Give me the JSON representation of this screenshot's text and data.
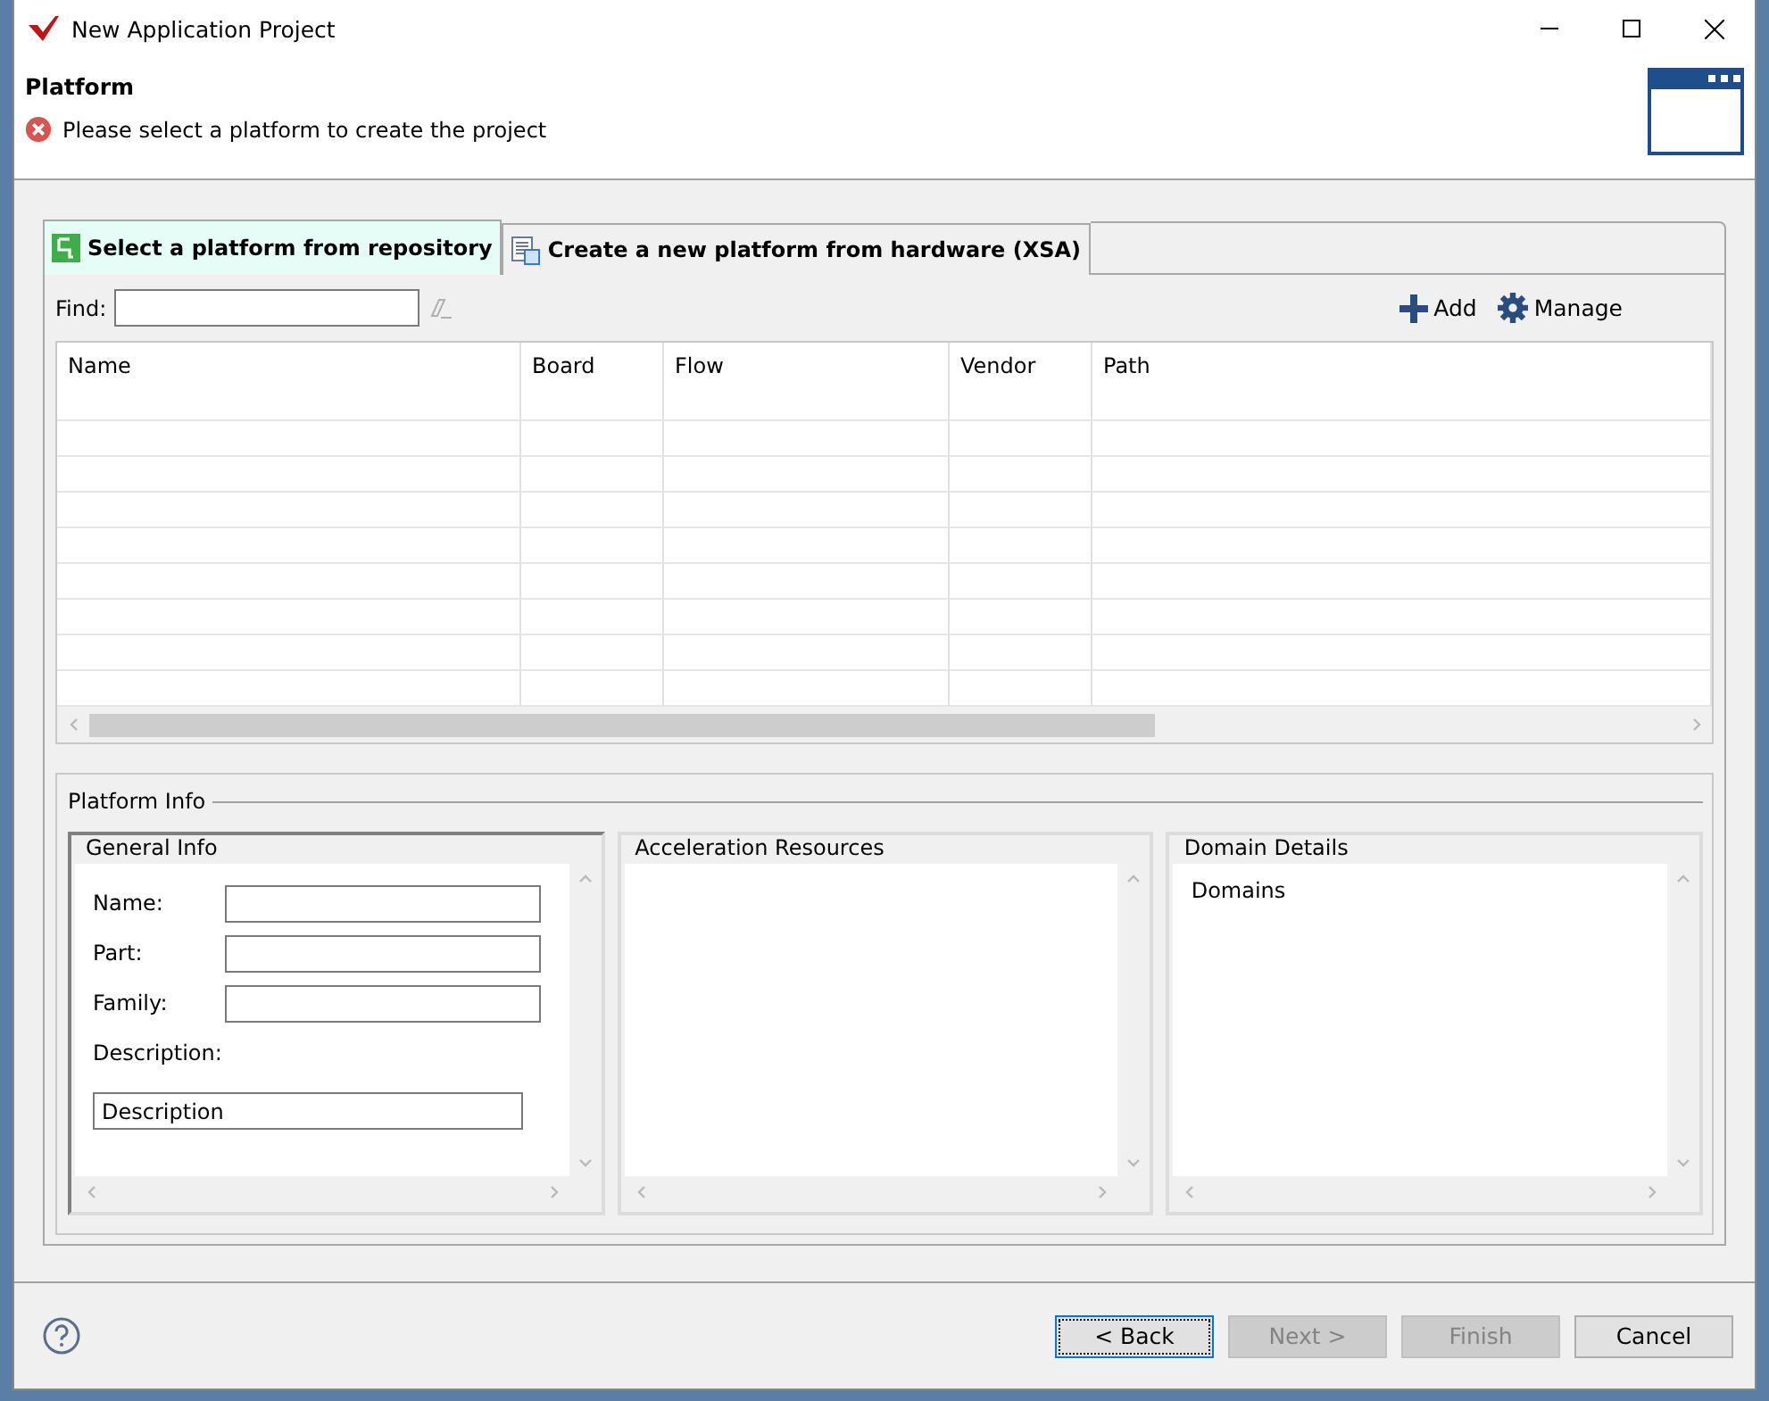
{
  "window": {
    "title": "New Application Project"
  },
  "header": {
    "title": "Platform",
    "message": "Please select a platform to create the project"
  },
  "tabs": [
    {
      "label": "Select a platform from repository",
      "selected": true
    },
    {
      "label": "Create a new platform from hardware (XSA)",
      "selected": false
    }
  ],
  "find": {
    "label": "Find:"
  },
  "toolbar": [
    {
      "kind": "add",
      "label": "Add"
    },
    {
      "kind": "manage",
      "label": "Manage"
    }
  ],
  "table": {
    "columns": [
      "Name",
      "Board",
      "Flow",
      "Vendor",
      "Path"
    ]
  },
  "platform_info": {
    "title": "Platform Info",
    "general_info": {
      "title": "General Info",
      "fields": [
        {
          "label": "Name:"
        },
        {
          "label": "Part:"
        },
        {
          "label": "Family:"
        }
      ],
      "description": {
        "label": "Description:",
        "value": "Description"
      }
    },
    "acceleration_resources": {
      "title": "Acceleration Resources"
    },
    "domain_details": {
      "title": "Domain Details",
      "items": [
        "Domains"
      ]
    }
  },
  "buttons": [
    {
      "label": "< Back",
      "default": true,
      "disabled": false
    },
    {
      "label": "Next >",
      "default": false,
      "disabled": true
    },
    {
      "label": "Finish",
      "default": false,
      "disabled": true
    },
    {
      "label": "Cancel",
      "default": false,
      "disabled": false
    }
  ]
}
